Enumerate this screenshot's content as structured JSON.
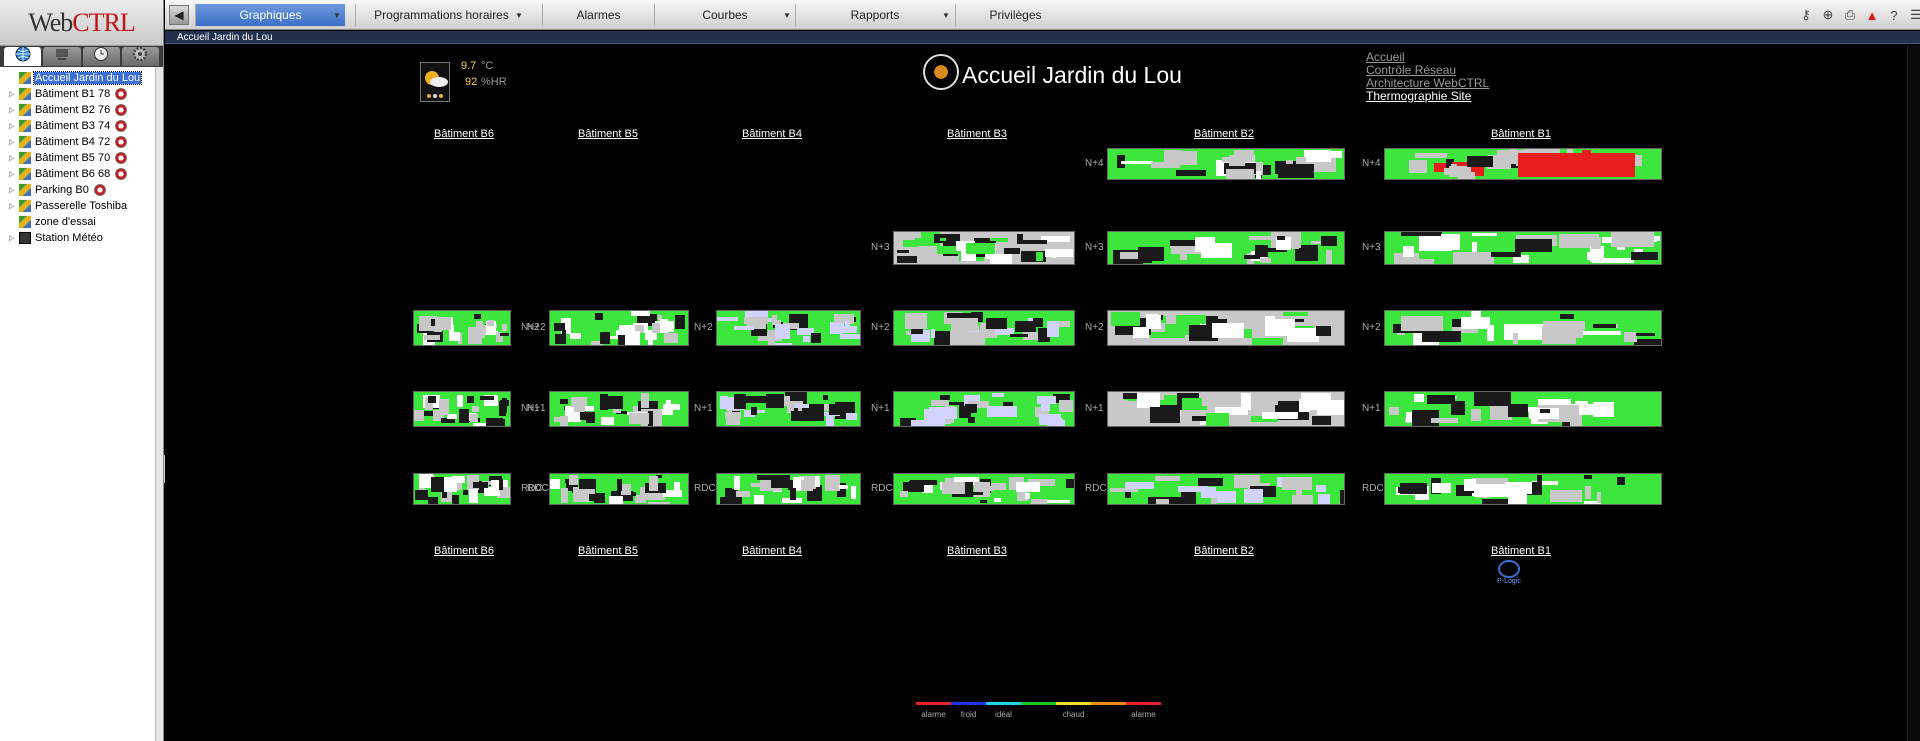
{
  "app": {
    "logo_web": "Web",
    "logo_ctrl": "CTRL"
  },
  "left_tabs": [
    {
      "name": "geographic-tab",
      "icon": "globe-icon"
    },
    {
      "name": "network-tab",
      "icon": "network-icon"
    },
    {
      "name": "schedules-tab",
      "icon": "clock-icon"
    },
    {
      "name": "config-tab",
      "icon": "gear-icon"
    }
  ],
  "tree": [
    {
      "label": "Accueil Jardin du Lou",
      "selected": true,
      "has_children": false,
      "badge": false,
      "icon": "site-icon"
    },
    {
      "label": "Bâtiment B1 78",
      "has_children": true,
      "badge": true,
      "icon": "building-icon"
    },
    {
      "label": "Bâtiment B2 76",
      "has_children": true,
      "badge": true,
      "icon": "building-icon"
    },
    {
      "label": "Bâtiment B3 74",
      "has_children": true,
      "badge": true,
      "icon": "building-icon"
    },
    {
      "label": "Bâtiment B4 72",
      "has_children": true,
      "badge": true,
      "icon": "building-icon"
    },
    {
      "label": "Bâtiment B5 70",
      "has_children": true,
      "badge": true,
      "icon": "building-icon"
    },
    {
      "label": "Bâtiment B6 68",
      "has_children": true,
      "badge": true,
      "icon": "building-icon"
    },
    {
      "label": "Parking B0",
      "has_children": true,
      "badge": true,
      "icon": "building-icon"
    },
    {
      "label": "Passerelle Toshiba",
      "has_children": true,
      "badge": false,
      "icon": "building-icon"
    },
    {
      "label": "zone d'essai",
      "has_children": false,
      "badge": false,
      "icon": "building-icon"
    },
    {
      "label": "Station Météo",
      "has_children": true,
      "badge": false,
      "icon": "weather-station-icon"
    }
  ],
  "menu": {
    "back_icon": "arrow-left-icon",
    "items": [
      {
        "label": "Graphiques",
        "active": true,
        "dropdown": true
      },
      {
        "label": "Programmations horaires",
        "active": false,
        "dropdown": true
      },
      {
        "label": "Alarmes",
        "active": false,
        "dropdown": false
      },
      {
        "label": "Courbes",
        "active": false,
        "dropdown": true
      },
      {
        "label": "Rapports",
        "active": false,
        "dropdown": true
      },
      {
        "label": "Privilèges",
        "active": false,
        "dropdown": false
      }
    ],
    "right_icons": [
      "key-icon",
      "settings-wheel-icon",
      "print-icon",
      "alarm-icon",
      "help-icon",
      "menu-icon"
    ]
  },
  "breadcrumb": "Accueil Jardin du Lou",
  "weather": {
    "temp": "9.7",
    "temp_unit": "°C",
    "humidity": "92",
    "humidity_unit": "%HR"
  },
  "page_title": "Accueil Jardin du Lou",
  "links": [
    {
      "label": "Accueil",
      "current": false
    },
    {
      "label": "Contrôle Réseau",
      "current": false
    },
    {
      "label": "Architecture WebCTRL",
      "current": false
    },
    {
      "label": "Thermographie Site",
      "current": true
    }
  ],
  "buildings": [
    "Bâtiment B6",
    "Bâtiment B5",
    "Bâtiment B4",
    "Bâtiment B3",
    "Bâtiment B2",
    "Bâtiment B1"
  ],
  "floor_levels": [
    "N+4",
    "N+3",
    "N+2",
    "N+1",
    "RDC"
  ],
  "floor_plans": [
    {
      "building": "B2",
      "level": "N+4",
      "tone": "mostly-green"
    },
    {
      "building": "B1",
      "level": "N+4",
      "tone": "green-red"
    },
    {
      "building": "B3",
      "level": "N+3",
      "tone": "mostly-grey"
    },
    {
      "building": "B2",
      "level": "N+3",
      "tone": "mostly-green"
    },
    {
      "building": "B1",
      "level": "N+3",
      "tone": "mostly-green"
    },
    {
      "building": "B6",
      "level": "N+2",
      "tone": "mostly-green"
    },
    {
      "building": "B5",
      "level": "N+2",
      "tone": "mostly-green"
    },
    {
      "building": "B4",
      "level": "N+2",
      "tone": "mixed"
    },
    {
      "building": "B3",
      "level": "N+2",
      "tone": "mixed"
    },
    {
      "building": "B2",
      "level": "N+2",
      "tone": "mostly-grey"
    },
    {
      "building": "B1",
      "level": "N+2",
      "tone": "mostly-green"
    },
    {
      "building": "B6",
      "level": "N+1",
      "tone": "mostly-green"
    },
    {
      "building": "B5",
      "level": "N+1",
      "tone": "mostly-green"
    },
    {
      "building": "B4",
      "level": "N+1",
      "tone": "mixed"
    },
    {
      "building": "B3",
      "level": "N+1",
      "tone": "mixed"
    },
    {
      "building": "B2",
      "level": "N+1",
      "tone": "mostly-grey"
    },
    {
      "building": "B1",
      "level": "N+1",
      "tone": "mostly-green"
    },
    {
      "building": "B6",
      "level": "RDC",
      "tone": "mostly-green"
    },
    {
      "building": "B5",
      "level": "RDC",
      "tone": "mostly-green"
    },
    {
      "building": "B4",
      "level": "RDC",
      "tone": "mostly-green"
    },
    {
      "building": "B3",
      "level": "RDC",
      "tone": "mostly-green"
    },
    {
      "building": "B2",
      "level": "RDC",
      "tone": "mixed"
    },
    {
      "building": "B1",
      "level": "RDC",
      "tone": "mostly-green"
    }
  ],
  "legend": [
    {
      "label": "alarme",
      "color": "#e8202a"
    },
    {
      "label": "froid",
      "color": "#1e32e8"
    },
    {
      "label": "idéal",
      "color": "#23d2e6"
    },
    {
      "label": "",
      "color": "#22c822"
    },
    {
      "label": "chaud",
      "color": "#f0e02a"
    },
    {
      "label": "",
      "color": "#ee8a1a"
    },
    {
      "label": "alarme",
      "color": "#e8202a"
    }
  ],
  "vendor_logo": "TC",
  "vendor_name": "P-Logic",
  "tones": {
    "mostly-green": {
      "base": "#3ce63c",
      "alt": [
        "#c8c8c8",
        "#1a1a1a",
        "#ffffff"
      ]
    },
    "green-red": {
      "base": "#3ce63c",
      "alt": [
        "#e81d1d",
        "#c8c8c8",
        "#1a1a1a"
      ]
    },
    "mostly-grey": {
      "base": "#c8c8c8",
      "alt": [
        "#3ce63c",
        "#1a1a1a",
        "#ffffff"
      ]
    },
    "mixed": {
      "base": "#3ce63c",
      "alt": [
        "#c8c8c8",
        "#1a1a1a",
        "#d2d2ff"
      ]
    }
  }
}
